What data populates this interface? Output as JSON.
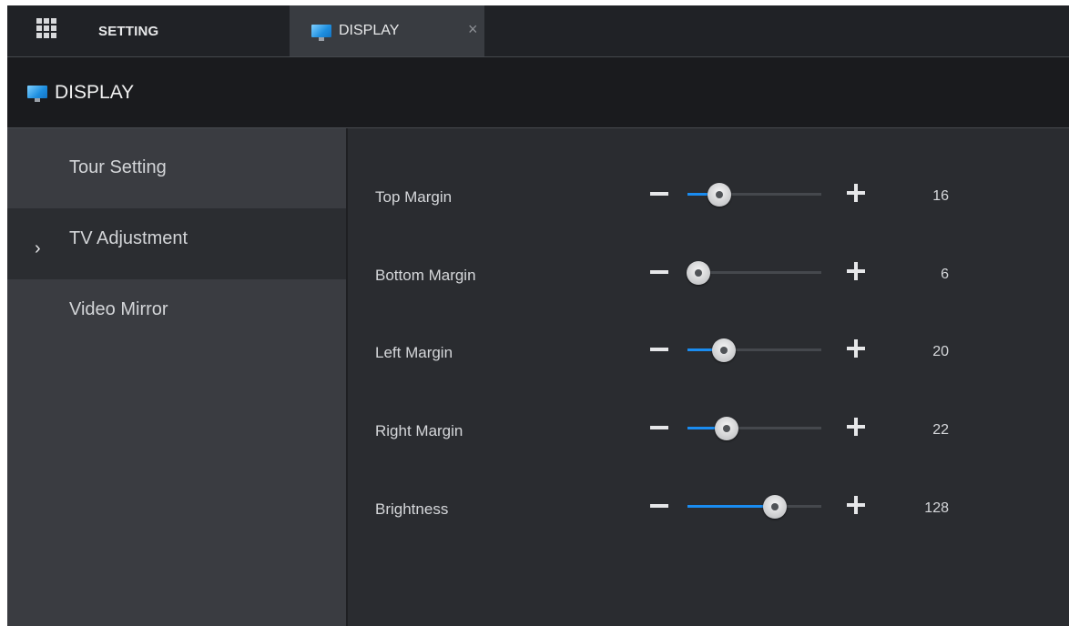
{
  "tabs": {
    "setting_label": "SETTING",
    "display_label": "DISPLAY",
    "close_symbol": "×"
  },
  "header": {
    "title": "DISPLAY"
  },
  "sidebar": {
    "items": [
      {
        "label": "Tour Setting",
        "active": false
      },
      {
        "label": "TV Adjustment",
        "active": true,
        "marker": "›"
      },
      {
        "label": "Video Mirror",
        "active": false
      }
    ]
  },
  "settings": [
    {
      "label": "Top Margin",
      "value": "16",
      "fraction": 0.24
    },
    {
      "label": "Bottom Margin",
      "value": "6",
      "fraction": 0.08
    },
    {
      "label": "Left Margin",
      "value": "20",
      "fraction": 0.27
    },
    {
      "label": "Right Margin",
      "value": "22",
      "fraction": 0.29
    },
    {
      "label": "Brightness",
      "value": "128",
      "fraction": 0.65
    }
  ],
  "colors": {
    "accent": "#1a8cf0",
    "background": "#2a2c30",
    "sidebar": "#3a3c41",
    "header": "#1a1b1e"
  },
  "icons": {
    "app_menu": "grid-icon",
    "display": "monitor-icon",
    "decrease": "minus-icon",
    "increase": "plus-icon"
  }
}
